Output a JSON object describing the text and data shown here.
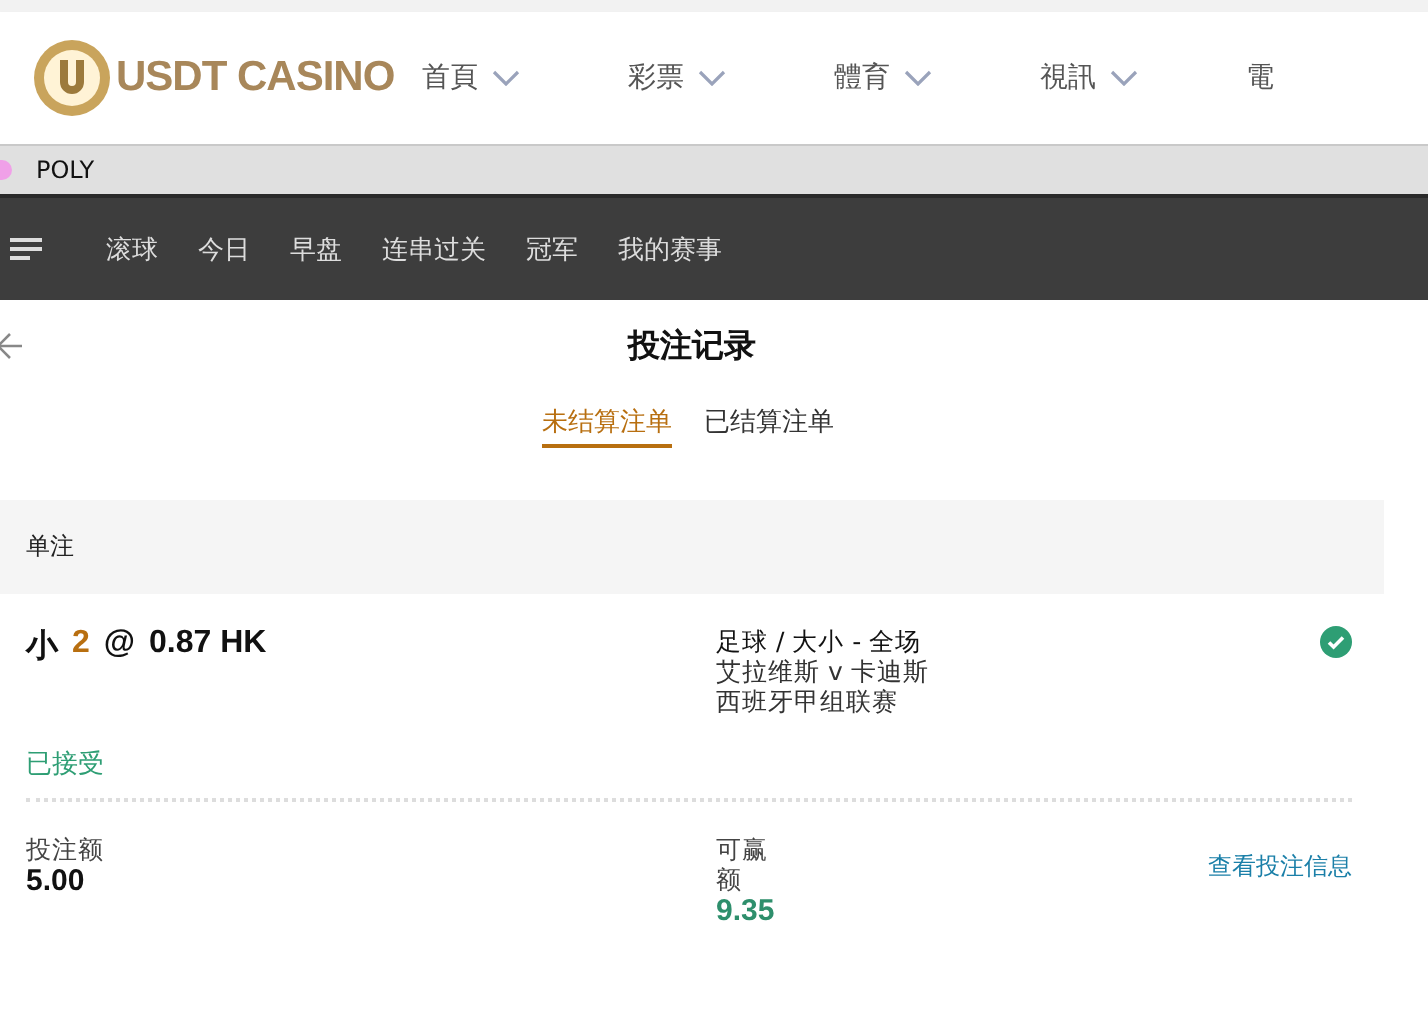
{
  "header": {
    "logo": "USDT CASINO",
    "nav": [
      "首頁",
      "彩票",
      "體育",
      "視訊",
      "電"
    ]
  },
  "provider_bar": {
    "label": "POLY"
  },
  "sports_nav": {
    "items": [
      "滚球",
      "今日",
      "早盘",
      "连串过关",
      "冠军",
      "我的赛事"
    ]
  },
  "page": {
    "title": "投注记录",
    "tabs": [
      {
        "label": "未结算注单",
        "selected": true
      },
      {
        "label": "已结算注单",
        "selected": false
      }
    ],
    "section": "单注",
    "bet": {
      "pick": "小",
      "line": "2",
      "at": "@",
      "odds": "0.87 HK",
      "sport_market": "足球 / 大小 - 全场",
      "match": "艾拉维斯 v 卡迪斯",
      "league": "西班牙甲组联赛",
      "status": "已接受",
      "accepted": true,
      "stake_label": "投注额",
      "stake": "5.00",
      "win_label": "可赢额",
      "win": "9.35",
      "details_link": "查看投注信息"
    }
  }
}
